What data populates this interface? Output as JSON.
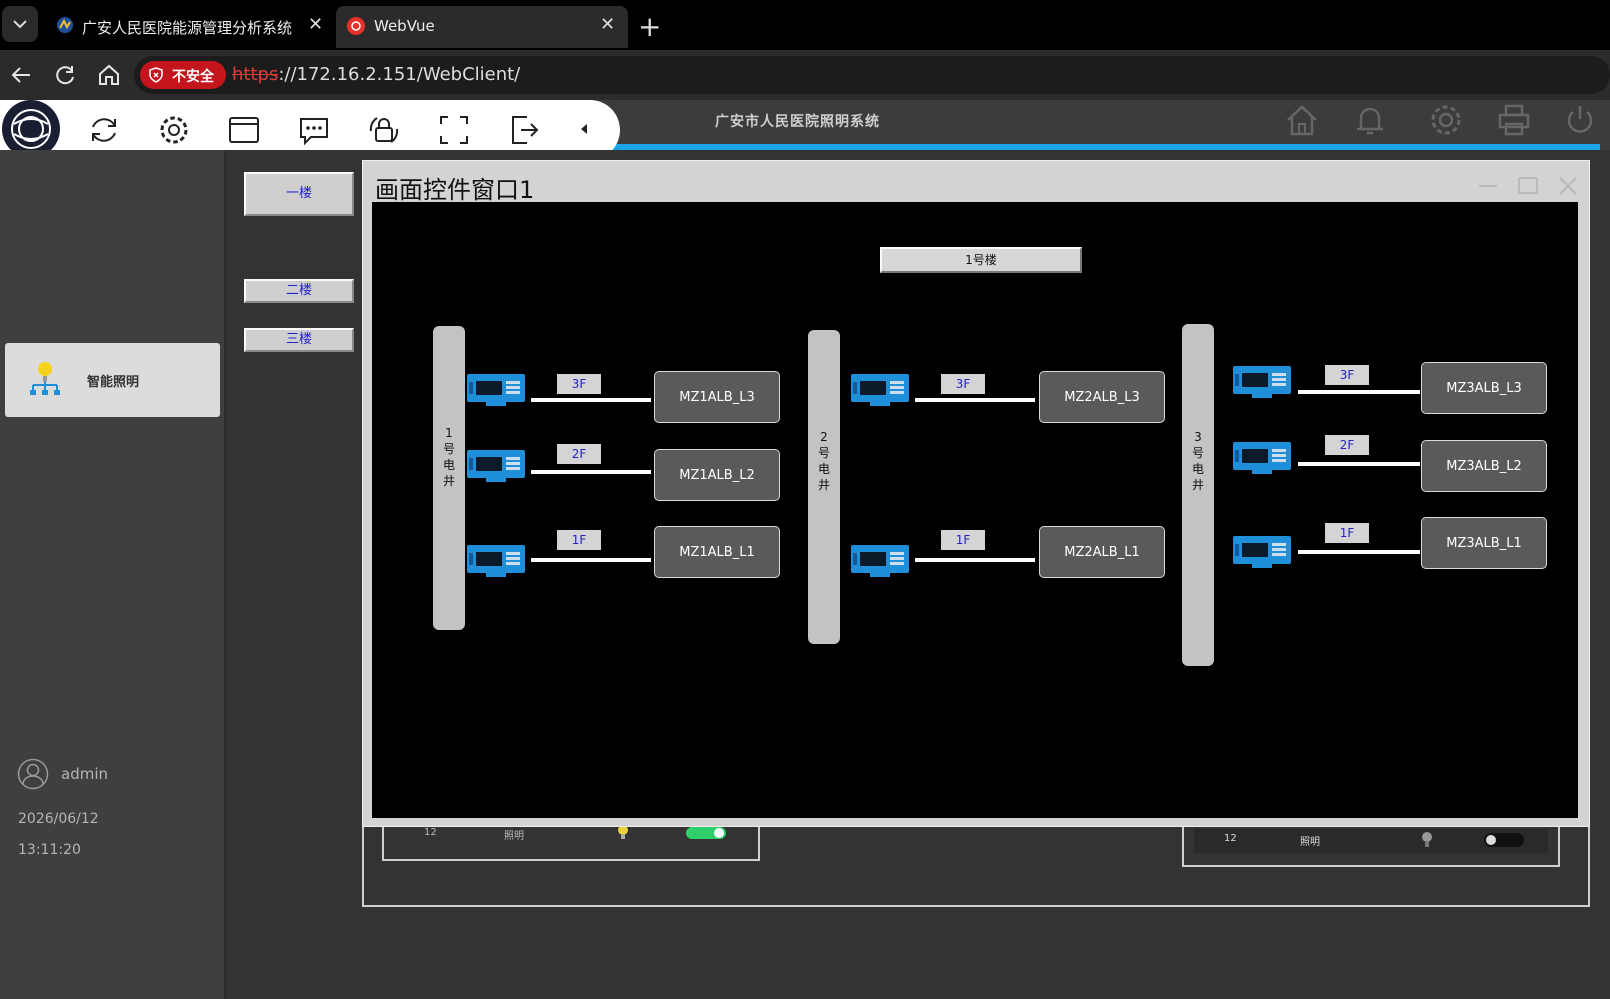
{
  "browser": {
    "tabs": [
      {
        "label": "广安人民医院能源管理分析系统",
        "active": false
      },
      {
        "label": "WebVue",
        "active": true
      }
    ],
    "security_label": "不安全",
    "url_scheme": "https",
    "url_rest": "://172.16.2.151/WebClient/"
  },
  "app": {
    "title": "广安市人民医院照明系统",
    "toolbar_icons": [
      "logo-icon",
      "refresh-icon",
      "gear-icon",
      "window-icon",
      "chat-icon",
      "lock-icon",
      "fullscreen-icon",
      "logout-icon",
      "collapse-arrow-icon"
    ],
    "header_icons": [
      "home-icon",
      "bell-icon",
      "gear-icon",
      "printer-icon",
      "power-icon"
    ]
  },
  "sidebar": {
    "nav_item": "智能照明",
    "user": "admin",
    "date": "2026/06/12",
    "time": "13:11:20"
  },
  "floors": [
    "一楼",
    "二楼",
    "三楼"
  ],
  "popup": {
    "title": "画面控件窗口1",
    "building_button": "1号楼",
    "shafts": [
      {
        "label": [
          "1",
          "号",
          "电",
          "井"
        ]
      },
      {
        "label": [
          "2",
          "号",
          "电",
          "井"
        ]
      },
      {
        "label": [
          "3",
          "号",
          "电",
          "井"
        ]
      }
    ],
    "cabinets": [
      [
        "MZ1ALB_L3",
        "MZ1ALB_L2",
        "MZ1ALB_L1"
      ],
      [
        "MZ2ALB_L3",
        "MZ2ALB_L1"
      ],
      [
        "MZ3ALB_L3",
        "MZ3ALB_L2",
        "MZ3ALB_L1"
      ]
    ],
    "floor_tags": [
      "3F",
      "2F",
      "1F"
    ]
  },
  "background_rows": {
    "left": {
      "number": "12",
      "label": "照明"
    },
    "right": {
      "number": "12",
      "label": "照明"
    }
  },
  "colors": {
    "accent": "#17a5e8",
    "meter_blue": "#1e8fd8",
    "insecure_red": "#c4151c"
  }
}
